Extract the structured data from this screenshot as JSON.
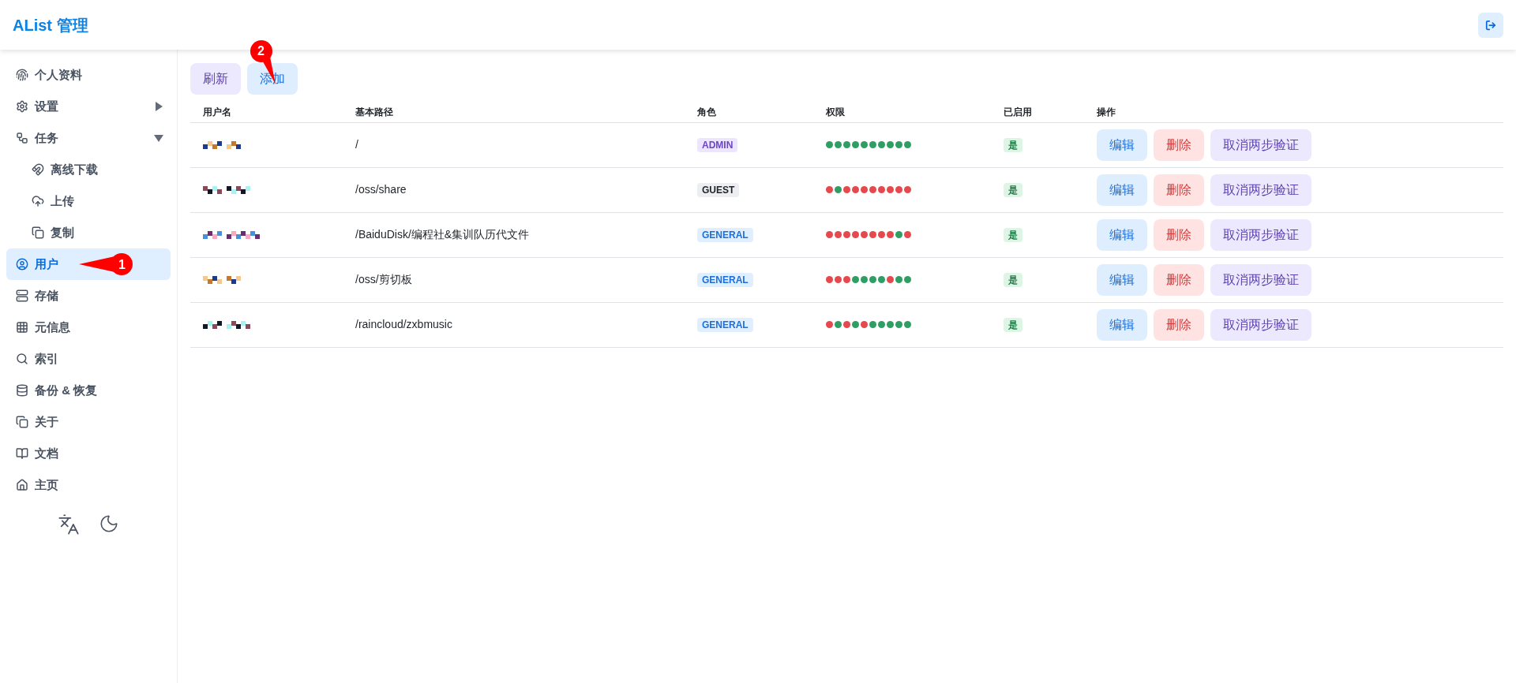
{
  "header": {
    "title": "AList 管理"
  },
  "sidebar": {
    "items": [
      {
        "label": "个人资料",
        "kind": "fingerprint",
        "selected": false
      },
      {
        "label": "设置",
        "kind": "gear",
        "selected": false,
        "expanded": false
      },
      {
        "label": "任务",
        "kind": "flow",
        "selected": false,
        "expanded": true,
        "children": [
          {
            "label": "离线下载",
            "kind": "magnet",
            "selected": false
          },
          {
            "label": "上传",
            "kind": "cloud",
            "selected": false
          },
          {
            "label": "复制",
            "kind": "copy",
            "selected": false
          }
        ]
      },
      {
        "label": "用户",
        "kind": "user",
        "selected": true
      },
      {
        "label": "存储",
        "kind": "storage",
        "selected": false
      },
      {
        "label": "元信息",
        "kind": "grid",
        "selected": false
      },
      {
        "label": "索引",
        "kind": "search",
        "selected": false
      },
      {
        "label": "备份 & 恢复",
        "kind": "database",
        "selected": false
      },
      {
        "label": "关于",
        "kind": "copy",
        "selected": false
      },
      {
        "label": "文档",
        "kind": "book",
        "selected": false
      },
      {
        "label": "主页",
        "kind": "home",
        "selected": false
      }
    ]
  },
  "toolbar": {
    "buttons": [
      {
        "label": "刷新",
        "kind": "refresh"
      },
      {
        "label": "添加",
        "kind": "add"
      }
    ]
  },
  "table": {
    "columns": [
      "用户名",
      "基本路径",
      "角色",
      "权限",
      "已启用",
      "操作"
    ],
    "rows": [
      {
        "path": "/",
        "role": {
          "label": "ADMIN",
          "kind": "admin"
        },
        "permissions": [
          true,
          true,
          true,
          true,
          true,
          true,
          true,
          true,
          true,
          true
        ],
        "enabled": "是",
        "actions": [
          "编辑",
          "删除",
          "取消两步验证"
        ]
      },
      {
        "path": "/oss/share",
        "role": {
          "label": "GUEST",
          "kind": "guest"
        },
        "permissions": [
          false,
          true,
          false,
          false,
          false,
          false,
          false,
          false,
          false,
          false
        ],
        "enabled": "是",
        "actions": [
          "编辑",
          "删除",
          "取消两步验证"
        ]
      },
      {
        "path": "/BaiduDisk/编程社&集训队历代文件",
        "role": {
          "label": "GENERAL",
          "kind": "general"
        },
        "permissions": [
          false,
          false,
          false,
          false,
          false,
          false,
          false,
          false,
          true,
          false
        ],
        "enabled": "是",
        "actions": [
          "编辑",
          "删除",
          "取消两步验证"
        ]
      },
      {
        "path": "/oss/剪切板",
        "role": {
          "label": "GENERAL",
          "kind": "general"
        },
        "permissions": [
          false,
          false,
          false,
          true,
          true,
          true,
          true,
          false,
          true,
          true
        ],
        "enabled": "是",
        "actions": [
          "编辑",
          "删除",
          "取消两步验证"
        ]
      },
      {
        "path": "/raincloud/zxbmusic",
        "role": {
          "label": "GENERAL",
          "kind": "general"
        },
        "permissions": [
          false,
          true,
          false,
          true,
          false,
          true,
          true,
          true,
          true,
          true
        ],
        "enabled": "是",
        "actions": [
          "编辑",
          "删除",
          "取消两步验证"
        ]
      }
    ]
  },
  "annotations": [
    {
      "text": "1"
    },
    {
      "text": "2"
    }
  ]
}
